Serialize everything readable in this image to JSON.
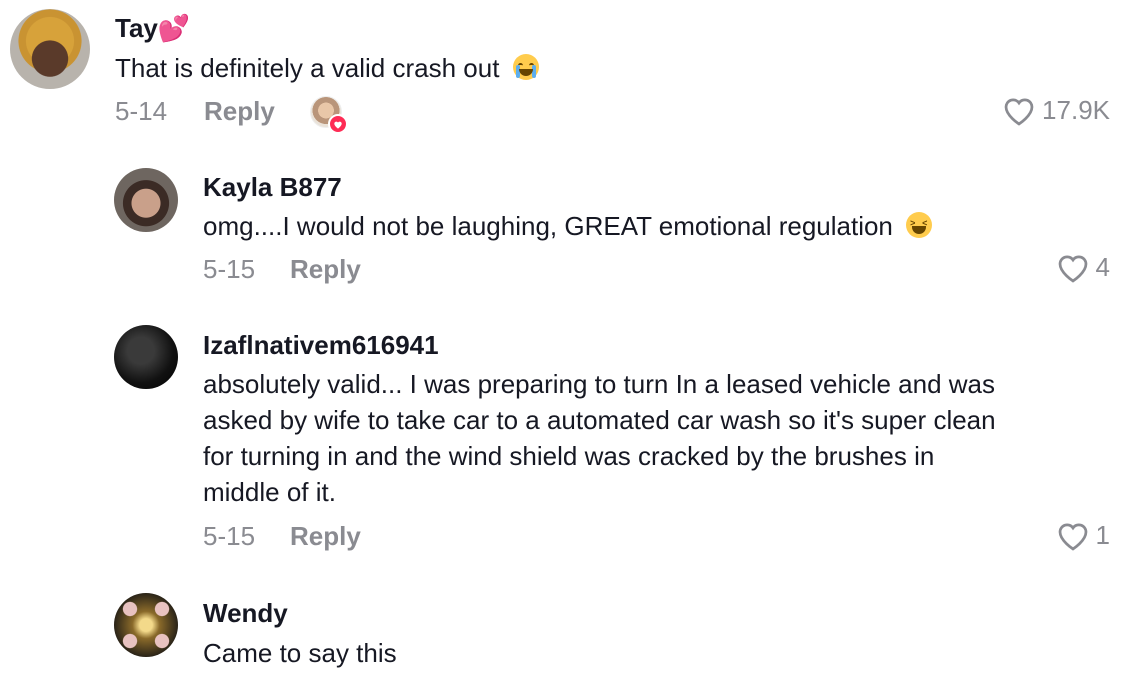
{
  "comments": [
    {
      "username": "Tay💕",
      "text": "That is definitely a valid crash out",
      "emoji": "😭",
      "date": "5-14",
      "reply_label": "Reply",
      "likes": "17.9K",
      "liked_by_creator": true
    },
    {
      "username": "Kayla B877",
      "text": "omg....I would not be laughing, GREAT emotional regulation",
      "emoji": "😆",
      "date": "5-15",
      "reply_label": "Reply",
      "likes": "4"
    },
    {
      "username": "Izaflnativem616941",
      "text_lines": [
        "absolutely valid... I was preparing to turn In a leased vehicle and was",
        "asked by wife to take car to a automated car wash so it's super clean",
        "for turning in and the wind shield was cracked by the brushes in",
        "middle of it."
      ],
      "date": "5-15",
      "reply_label": "Reply",
      "likes": "1"
    },
    {
      "username": "Wendy",
      "text": "Came to say this"
    }
  ],
  "colors": {
    "primary_text": "#161823",
    "secondary_text": "#8a8b91",
    "like_heart_badge": "#fe2c55"
  },
  "icons": {
    "like": "heart-outline-icon",
    "creator_like_badge": "heart-icon"
  }
}
